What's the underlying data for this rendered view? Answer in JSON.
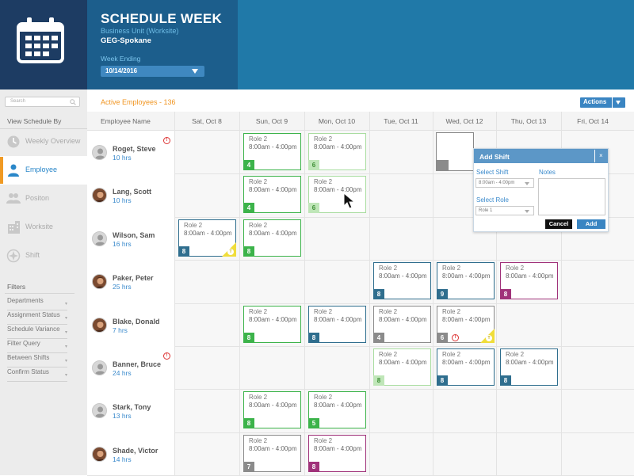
{
  "header": {
    "title": "SCHEDULE WEEK",
    "business_unit_label": "Business Unit (Worksite)",
    "worksite": "GEG-Spokane",
    "week_ending_label": "Week Ending",
    "week_ending_value": "10/14/2016"
  },
  "sidebar": {
    "search_placeholder": "Search",
    "view_by_label": "View Schedule By",
    "items": [
      {
        "label": "Weekly Overview",
        "icon": "clock-icon",
        "active": false
      },
      {
        "label": "Employee",
        "icon": "person-icon",
        "active": true
      },
      {
        "label": "Positon",
        "icon": "group-icon",
        "active": false
      },
      {
        "label": "Worksite",
        "icon": "building-icon",
        "active": false
      },
      {
        "label": "Shift",
        "icon": "compass-icon",
        "active": false
      }
    ],
    "filters_label": "Filters",
    "filters": [
      "Departments",
      "Assignment Status",
      "Schedule Variance",
      "Filter Query",
      "Between Shifts",
      "Confirm Status"
    ]
  },
  "main": {
    "active_employees": "Active Employees - 136",
    "actions_label": "Actions",
    "columns": [
      "Employee Name",
      "Sat, Oct 8",
      "Sun, Oct 9",
      "Mon, Oct 10",
      "Tue, Oct 11",
      "Wed, Oct 12",
      "Thu, Oct 13",
      "Fri, Oct 14"
    ],
    "employees": [
      {
        "name": "Roget, Steve",
        "hrs": "10 hrs",
        "alert": "!"
      },
      {
        "name": "Lang, Scott",
        "hrs": "10 hrs"
      },
      {
        "name": "Wilson, Sam",
        "hrs": "16 hrs"
      },
      {
        "name": "Paker, Peter",
        "hrs": "25 hrs"
      },
      {
        "name": "Blake, Donald",
        "hrs": "7 hrs"
      },
      {
        "name": "Banner, Bruce",
        "hrs": "24 hrs",
        "alert": "!"
      },
      {
        "name": "Stark, Tony",
        "hrs": "13 hrs"
      },
      {
        "name": "Shade, Victor",
        "hrs": "14 hrs"
      }
    ],
    "shift_role": "Role 2",
    "shift_time": "8:00am - 4:00pm",
    "shifts": [
      {
        "row": 0,
        "day": 1,
        "num": "4",
        "color": "green"
      },
      {
        "row": 0,
        "day": 2,
        "num": "6",
        "color": "lgreen"
      },
      {
        "row": 1,
        "day": 1,
        "num": "4",
        "color": "green"
      },
      {
        "row": 1,
        "day": 2,
        "num": "6",
        "color": "lgreen"
      },
      {
        "row": 2,
        "day": 0,
        "num": "8",
        "color": "blue",
        "corner": "T"
      },
      {
        "row": 2,
        "day": 1,
        "num": "8",
        "color": "green"
      },
      {
        "row": 3,
        "day": 3,
        "num": "8",
        "color": "blue"
      },
      {
        "row": 3,
        "day": 4,
        "num": "9",
        "color": "blue"
      },
      {
        "row": 3,
        "day": 5,
        "num": "8",
        "color": "purple"
      },
      {
        "row": 4,
        "day": 1,
        "num": "8",
        "color": "green"
      },
      {
        "row": 4,
        "day": 2,
        "num": "8",
        "color": "blue"
      },
      {
        "row": 4,
        "day": 3,
        "num": "4",
        "color": "gray"
      },
      {
        "row": 4,
        "day": 4,
        "num": "6",
        "color": "gray",
        "corner": "T",
        "alert": "!"
      },
      {
        "row": 5,
        "day": 3,
        "num": "8",
        "color": "lgreen"
      },
      {
        "row": 5,
        "day": 4,
        "num": "8",
        "color": "blue"
      },
      {
        "row": 5,
        "day": 5,
        "num": "8",
        "color": "blue"
      },
      {
        "row": 6,
        "day": 1,
        "num": "8",
        "color": "green"
      },
      {
        "row": 6,
        "day": 2,
        "num": "5",
        "color": "green"
      },
      {
        "row": 7,
        "day": 1,
        "num": "7",
        "color": "gray"
      },
      {
        "row": 7,
        "day": 2,
        "num": "8",
        "color": "purple"
      }
    ]
  },
  "popup": {
    "title": "Add Shift",
    "close": "×",
    "select_shift_label": "Select Shift",
    "select_shift_value": "8:00am - 4:00pm",
    "select_role_label": "Select Role",
    "select_role_value": "Role 1",
    "notes_label": "Notes",
    "cancel_label": "Cancel",
    "add_label": "Add"
  },
  "colors": {
    "header_bg": "#2079a8",
    "header_dark": "#1d3c63",
    "accent_orange": "#f09a24",
    "green": "#3cb34a",
    "blue": "#2f6e8e",
    "gray": "#8b8b8b",
    "purple": "#a0327a"
  }
}
